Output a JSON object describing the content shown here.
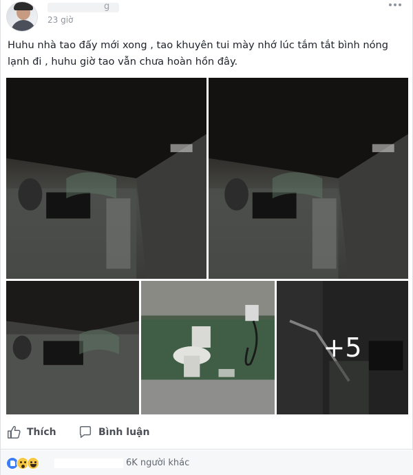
{
  "post": {
    "timestamp": "23 giờ",
    "author_tail": "g",
    "text": "Huhu nhà tao đấy mới xong , tao khuyên tui mày nhớ lúc tắm tắt bình nóng lạnh đi , huhu giờ tao vẫn chưa hoàn hồn đây.",
    "more_photos": "+5"
  },
  "actions": {
    "like_label": "Thích",
    "comment_label": "Bình luận"
  },
  "reactions": {
    "summary": "6K người khác",
    "icons": [
      "like-icon",
      "wow-icon",
      "haha-icon"
    ]
  },
  "colors": {
    "primary_text": "#1d2129",
    "secondary_text": "#90949c",
    "action_text": "#4b4f56",
    "like_blue": "#3b7ef3",
    "emoji_yellow": "#f7c744"
  }
}
